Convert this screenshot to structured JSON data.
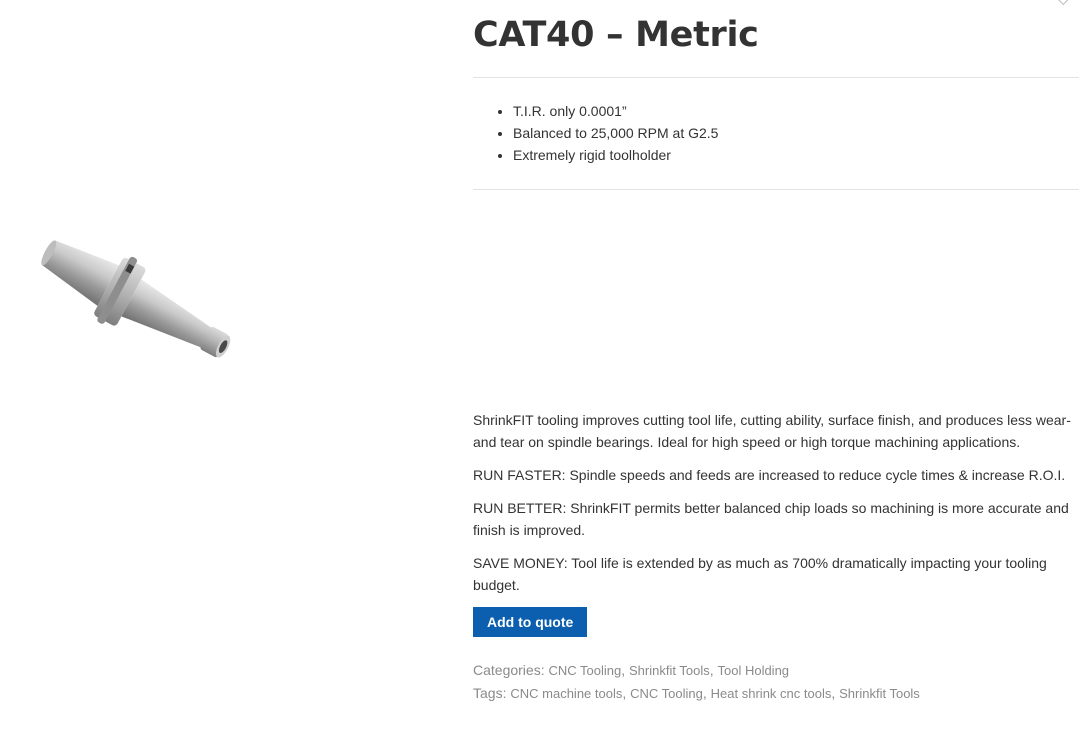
{
  "product": {
    "title": "CAT40 – Metric",
    "image_icon": "toolholder-image",
    "features": [
      "T.I.R. only 0.0001”",
      "Balanced to 25,000 RPM at G2.5",
      "Extremely rigid toolholder"
    ],
    "description": [
      "ShrinkFIT tooling improves cutting tool life, cutting ability, surface finish, and produces less wear-and tear on spindle bearings. Ideal for high speed or high torque machining applications.",
      "RUN FASTER: Spindle speeds and feeds are increased to reduce cycle times & increase R.O.I.",
      "RUN BETTER: ShrinkFIT permits better balanced chip loads so machining is more accurate and finish is improved.",
      "SAVE MONEY: Tool life is extended by as much as 700% dramatically impacting your tooling budget."
    ],
    "add_to_quote_label": "Add to quote"
  },
  "meta": {
    "categories_label": "Categories:",
    "categories": [
      "CNC Tooling",
      "Shrinkfit Tools",
      "Tool Holding"
    ],
    "tags_label": "Tags:",
    "tags": [
      "CNC machine tools",
      "CNC Tooling",
      "Heat shrink cnc tools",
      "Shrinkfit Tools"
    ]
  },
  "colors": {
    "button_background": "#0b5fae",
    "title_text": "#333333",
    "meta_text": "#8a8a8a"
  }
}
